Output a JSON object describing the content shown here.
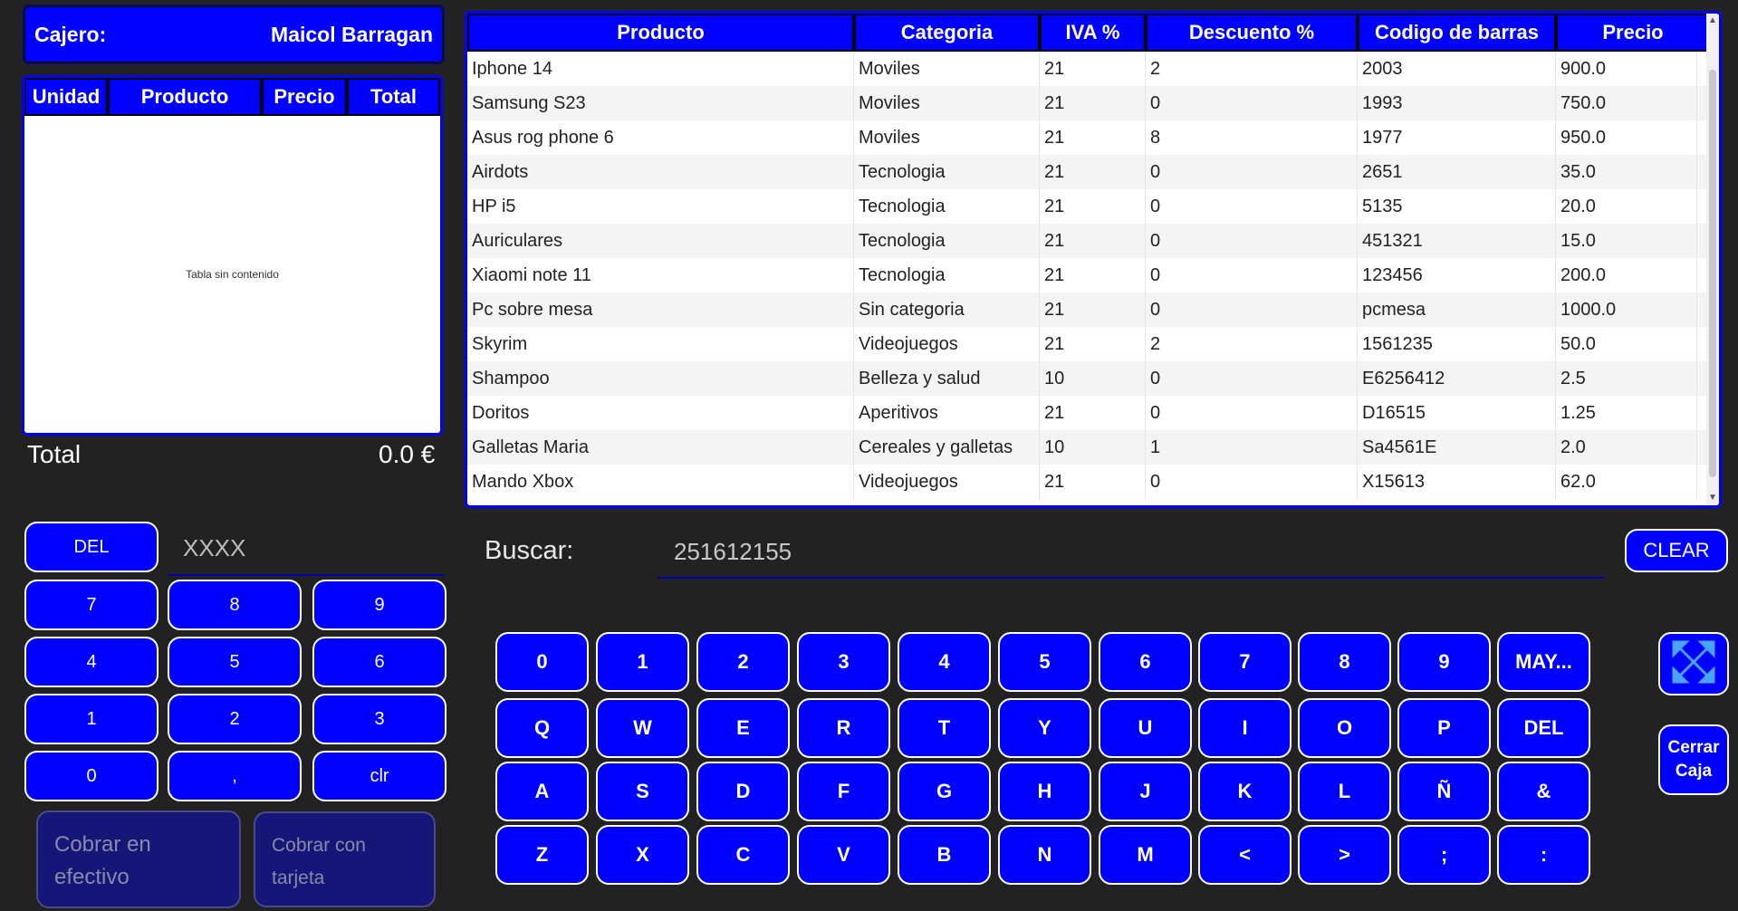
{
  "cashier": {
    "label": "Cajero:",
    "name": "Maicol Barragan"
  },
  "ticket": {
    "headers": [
      "Unidad",
      "Producto",
      "Precio",
      "Total"
    ],
    "empty_text": "Tabla sin contenido",
    "total_label": "Total",
    "total_value": "0.0 €"
  },
  "products": {
    "headers": [
      "Producto",
      "Categoria",
      "IVA %",
      "Descuento %",
      "Codigo de barras",
      "Precio"
    ],
    "rows": [
      [
        "Iphone 14",
        "Moviles",
        "21",
        "2",
        "2003",
        "900.0"
      ],
      [
        "Samsung S23",
        "Moviles",
        "21",
        "0",
        "1993",
        "750.0"
      ],
      [
        "Asus rog phone 6",
        "Moviles",
        "21",
        "8",
        "1977",
        "950.0"
      ],
      [
        "Airdots",
        "Tecnologia",
        "21",
        "0",
        "2651",
        "35.0"
      ],
      [
        "HP i5",
        "Tecnologia",
        "21",
        "0",
        "5135",
        "20.0"
      ],
      [
        "Auriculares",
        "Tecnologia",
        "21",
        "0",
        "451321",
        "15.0"
      ],
      [
        "Xiaomi note 11",
        "Tecnologia",
        "21",
        "0",
        "123456",
        "200.0"
      ],
      [
        "Pc sobre mesa",
        "Sin categoria",
        "21",
        "0",
        "pcmesa",
        "1000.0"
      ],
      [
        "Skyrim",
        "Videojuegos",
        "21",
        "2",
        "1561235",
        "50.0"
      ],
      [
        "Shampoo",
        "Belleza y salud",
        "10",
        "0",
        "E6256412",
        "2.5"
      ],
      [
        "Doritos",
        "Aperitivos",
        "21",
        "0",
        "D16515",
        "1.25"
      ],
      [
        "Galletas Maria",
        "Cereales y galletas",
        "10",
        "1",
        "Sa4561E",
        "2.0"
      ],
      [
        "Mando Xbox",
        "Videojuegos",
        "21",
        "0",
        "X15613",
        "62.0"
      ]
    ]
  },
  "numpad": {
    "del_label": "DEL",
    "input_placeholder": "XXXX",
    "keys": [
      "7",
      "8",
      "9",
      "4",
      "5",
      "6",
      "1",
      "2",
      "3",
      "0",
      ",",
      "clr"
    ]
  },
  "payment": {
    "cash_label": "Cobrar en efectivo",
    "card_label": "Cobrar con tarjeta"
  },
  "search": {
    "label": "Buscar:",
    "value": "251612155",
    "clear_label": "CLEAR"
  },
  "keyboard": {
    "rows": [
      [
        "0",
        "1",
        "2",
        "3",
        "4",
        "5",
        "6",
        "7",
        "8",
        "9",
        "MAY..."
      ],
      [
        "Q",
        "W",
        "E",
        "R",
        "T",
        "Y",
        "U",
        "I",
        "O",
        "P",
        "DEL"
      ],
      [
        "A",
        "S",
        "D",
        "F",
        "G",
        "H",
        "J",
        "K",
        "L",
        "Ñ",
        "&"
      ],
      [
        "Z",
        "X",
        "C",
        "V",
        "B",
        "N",
        "M",
        "<",
        ">",
        ";",
        ":"
      ]
    ]
  },
  "side": {
    "fullscreen_icon": "expand-arrows-icon",
    "close_register_label": "Cerrar Caja"
  },
  "colors": {
    "accent": "#0000ff",
    "background": "#222222",
    "pay_disabled": "#161678"
  }
}
